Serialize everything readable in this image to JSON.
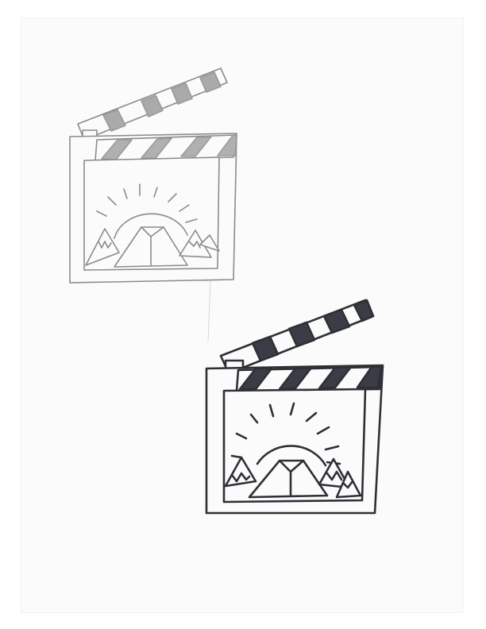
{
  "image": {
    "drawings": [
      {
        "subject": "clapperboard-icon",
        "medium": "pencil",
        "stroke_color": "#8b8b8b",
        "stripe_color": "#a8a8a8"
      },
      {
        "subject": "clapperboard-icon",
        "medium": "marker",
        "stroke_color": "#2e3036",
        "stripe_color": "#3a3d45"
      }
    ],
    "paper_color": "#fbfbfb",
    "background_color": "#ffffff"
  }
}
